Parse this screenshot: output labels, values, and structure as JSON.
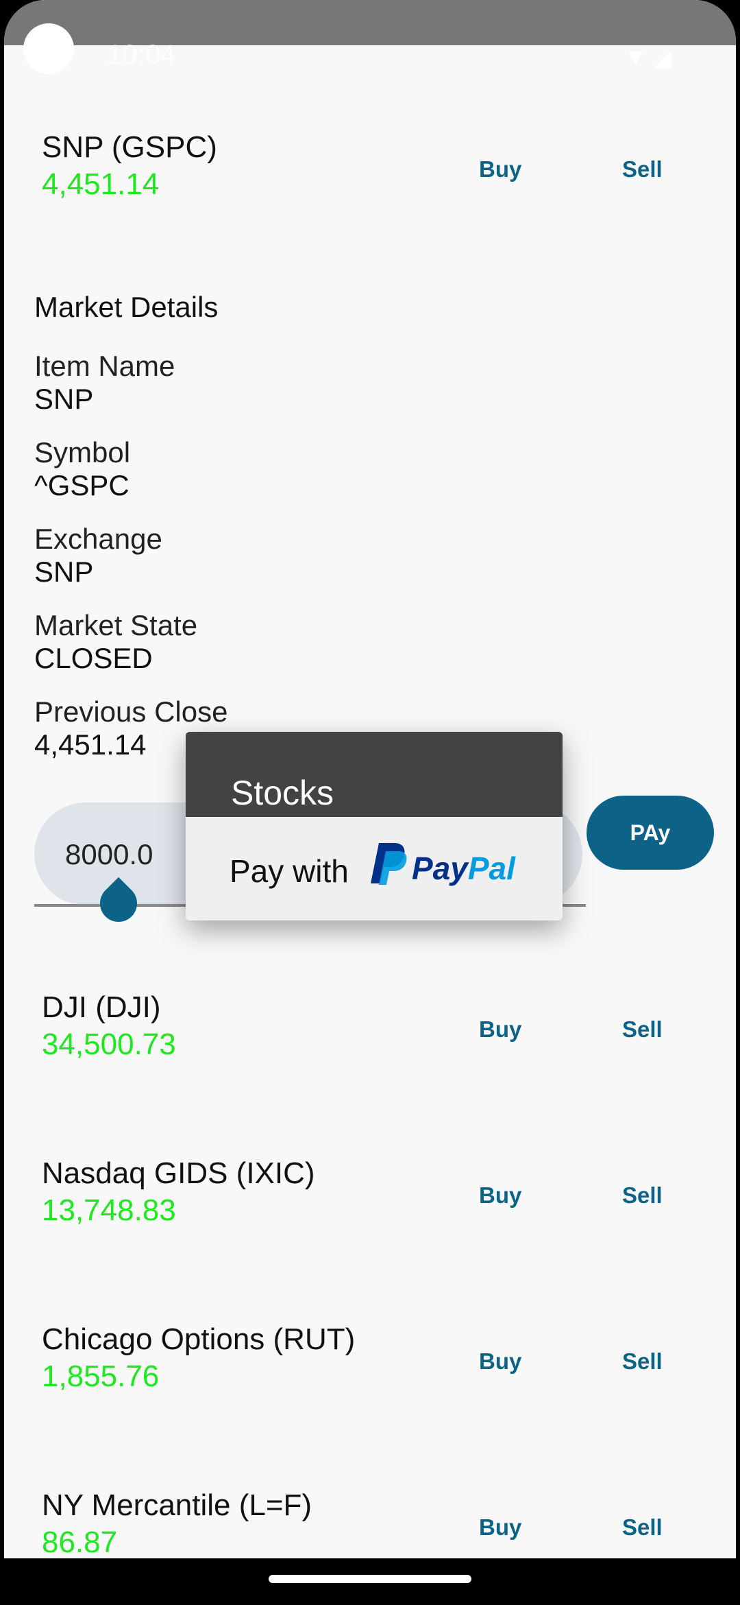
{
  "status_bar": {
    "time": "10:04"
  },
  "stocks": [
    {
      "name": "SNP (GSPC)",
      "price": "4,451.14",
      "buy": "Buy",
      "sell": "Sell"
    },
    {
      "name": "DJI (DJI)",
      "price": "34,500.73",
      "buy": "Buy",
      "sell": "Sell"
    },
    {
      "name": "Nasdaq GIDS (IXIC)",
      "price": "13,748.83",
      "buy": "Buy",
      "sell": "Sell"
    },
    {
      "name": "Chicago Options (RUT)",
      "price": "1,855.76",
      "buy": "Buy",
      "sell": "Sell"
    },
    {
      "name": "NY Mercantile (L=F)",
      "price": "86.87",
      "buy": "Buy",
      "sell": "Sell"
    }
  ],
  "details": {
    "title": "Market Details",
    "item_name_label": "Item Name",
    "item_name_value": "SNP",
    "symbol_label": "Symbol",
    "symbol_value": "^GSPC",
    "exchange_label": "Exchange",
    "exchange_value": "SNP",
    "market_state_label": "Market State",
    "market_state_value": "CLOSED",
    "previous_close_label": "Previous Close",
    "previous_close_value": "4,451.14"
  },
  "payment": {
    "amount": "8000.0",
    "pay_button": "PAy"
  },
  "dialog": {
    "title": "Stocks",
    "pay_with": "Pay with",
    "paypal_part1": "Pay",
    "paypal_part2": "Pal"
  },
  "colors": {
    "accent": "#0c6387",
    "price_green": "#1ee81e",
    "paypal_dark": "#003087",
    "paypal_light": "#009cde"
  }
}
